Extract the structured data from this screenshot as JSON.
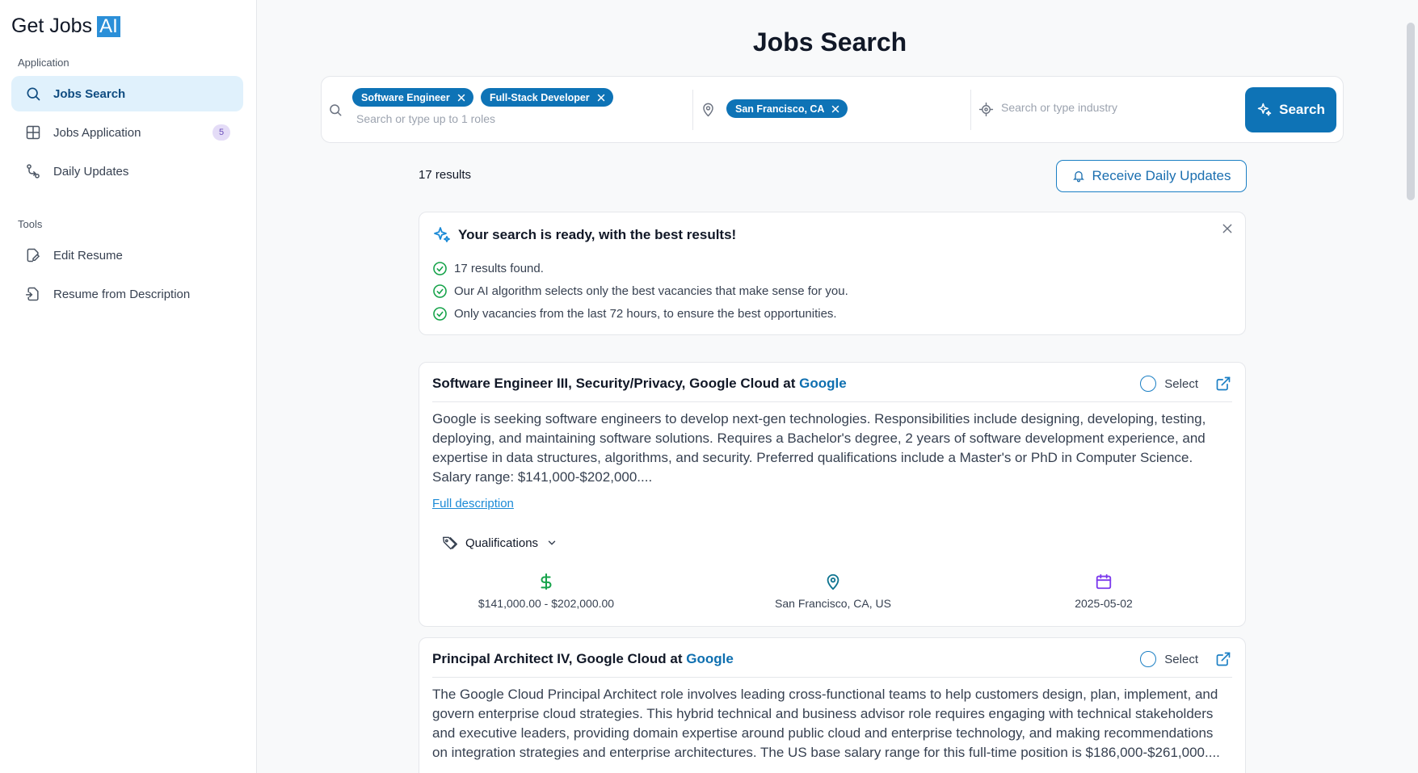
{
  "logo": {
    "text": "Get Jobs",
    "badge": "AI"
  },
  "sidebar": {
    "section_application": "Application",
    "section_tools": "Tools",
    "items": [
      {
        "label": "Jobs Search",
        "icon": "search-icon"
      },
      {
        "label": "Jobs Application",
        "icon": "grid-icon",
        "badge": "5"
      },
      {
        "label": "Daily Updates",
        "icon": "git-compare-icon"
      },
      {
        "label": "Edit Resume",
        "icon": "edit-document-icon"
      },
      {
        "label": "Resume from Description",
        "icon": "document-import-icon"
      }
    ]
  },
  "page": {
    "title": "Jobs Search"
  },
  "search": {
    "roles": [
      "Software Engineer",
      "Full-Stack Developer"
    ],
    "roles_placeholder": "Search or type up to 1 roles",
    "locations": [
      "San Francisco, CA"
    ],
    "industry_placeholder": "Search or type industry",
    "button_label": "Search"
  },
  "results": {
    "count_label": "17 results",
    "daily_button": "Receive Daily Updates"
  },
  "info": {
    "title": "Your search is ready, with the best results!",
    "points": [
      "17 results found.",
      "Our AI algorithm selects only the best vacancies that make sense for you.",
      "Only vacancies from the last 72 hours, to ensure the best opportunities."
    ]
  },
  "jobs": [
    {
      "title": "Software Engineer III, Security/Privacy, Google Cloud",
      "at": "at",
      "company": "Google",
      "select_label": "Select",
      "description": "Google is seeking software engineers to develop next-gen technologies. Responsibilities include designing, developing, testing, deploying, and maintaining software solutions. Requires a Bachelor's degree, 2 years of software development experience, and expertise in data structures, algorithms, and security. Preferred qualifications include a Master's or PhD in Computer Science. Salary range: $141,000-$202,000....",
      "full_description_link": "Full description",
      "qualifications_label": "Qualifications",
      "salary": "$141,000.00 - $202,000.00",
      "location": "San Francisco, CA, US",
      "date": "2025-05-02"
    },
    {
      "title": "Principal Architect IV, Google Cloud",
      "at": "at",
      "company": "Google",
      "select_label": "Select",
      "description": "The Google Cloud Principal Architect role involves leading cross-functional teams to help customers design, plan, implement, and govern enterprise cloud strategies. This hybrid technical and business advisor role requires engaging with technical stakeholders and executive leaders, providing domain expertise around public cloud and enterprise technology, and making recommendations on integration strategies and enterprise architectures. The US base salary range for this full-time position is $186,000-$261,000...."
    }
  ],
  "colors": {
    "primary": "#0e73b6",
    "active_nav_bg": "#e0f1fc",
    "success": "#16a34a",
    "salary_icon": "#16a34a",
    "location_icon": "#0e7490",
    "date_icon": "#7c3aed"
  }
}
